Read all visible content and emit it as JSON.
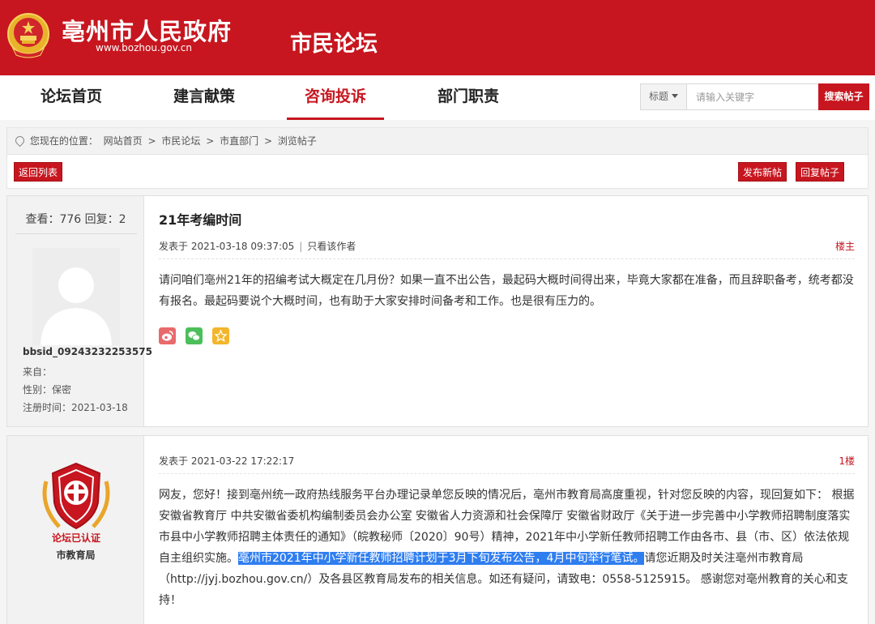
{
  "header": {
    "site_name": "亳州市人民政府",
    "site_url": "www.bozhou.gov.cn",
    "forum_name": "市民论坛"
  },
  "nav": {
    "items": [
      "论坛首页",
      "建言献策",
      "咨询投诉",
      "部门职责"
    ],
    "active": "咨询投诉"
  },
  "search": {
    "scope": "标题",
    "placeholder": "请输入关键字",
    "button": "搜索帖子"
  },
  "breadcrumb": {
    "prefix": "您现在的位置：",
    "items": [
      "网站首页",
      "市民论坛",
      "市直部门",
      "浏览帖子"
    ],
    "separator": ">"
  },
  "actions": {
    "back": "返回列表",
    "new_post": "发布新帖",
    "reply": "回复帖子"
  },
  "icons": {
    "location": "location-pin-icon",
    "weibo": "weibo-icon",
    "wechat": "wechat-icon",
    "favorite": "star-icon",
    "emblem": "national-emblem-icon",
    "badge": "forum-verified-badge-icon"
  },
  "colors": {
    "brand": "#c7161f",
    "highlight": "#2f7ef0"
  },
  "topic": {
    "stats": "查看：776 回复：2",
    "title": "21年考编时间",
    "posted": "发表于 2021-03-18 09:37:05",
    "author_only": "只看该作者",
    "floor": "楼主",
    "content": "请问咱们亳州21年的招编考试大概定在几月份？如果一直不出公告，最起码大概时间得出来，毕竟大家都在准备，而且辞职备考，统考都没有报名。最起码要说个大概时间，也有助于大家安排时间备考和工作。也是很有压力的。",
    "user": {
      "name": "bbsid_09243232253575",
      "from": "来自：",
      "gender": "性别：保密",
      "registered": "注册时间：2021-03-18"
    }
  },
  "reply": {
    "badge_text": "论坛已认证",
    "department": "市教育局",
    "posted": "发表于 2021-03-22 17:22:17",
    "floor": "1楼",
    "content_before": "网友，您好！接到亳州统一政府热线服务平台办理记录单您反映的情况后，亳州市教育局高度重视，针对您反映的内容，现回复如下： 根据安徽省教育厅 中共安徽省委机构编制委员会办公室 安徽省人力资源和社会保障厅 安徽省财政厅《关于进一步完善中小学教师招聘制度落实市县中小学教师招聘主体责任的通知》（皖教秘师〔2020〕90号）精神，2021年中小学新任教师招聘工作由各市、县（市、区）依法依规自主组织实施。",
    "content_highlight": "亳州市2021年中小学新任教师招聘计划于3月下旬发布公告，4月中旬举行笔试。",
    "content_after": "请您近期及时关注亳州市教育局（http://jyj.bozhou.gov.cn/）及各县区教育局发布的相关信息。如还有疑问，请致电：0558-5125915。 感谢您对亳州教育的关心和支持！"
  }
}
